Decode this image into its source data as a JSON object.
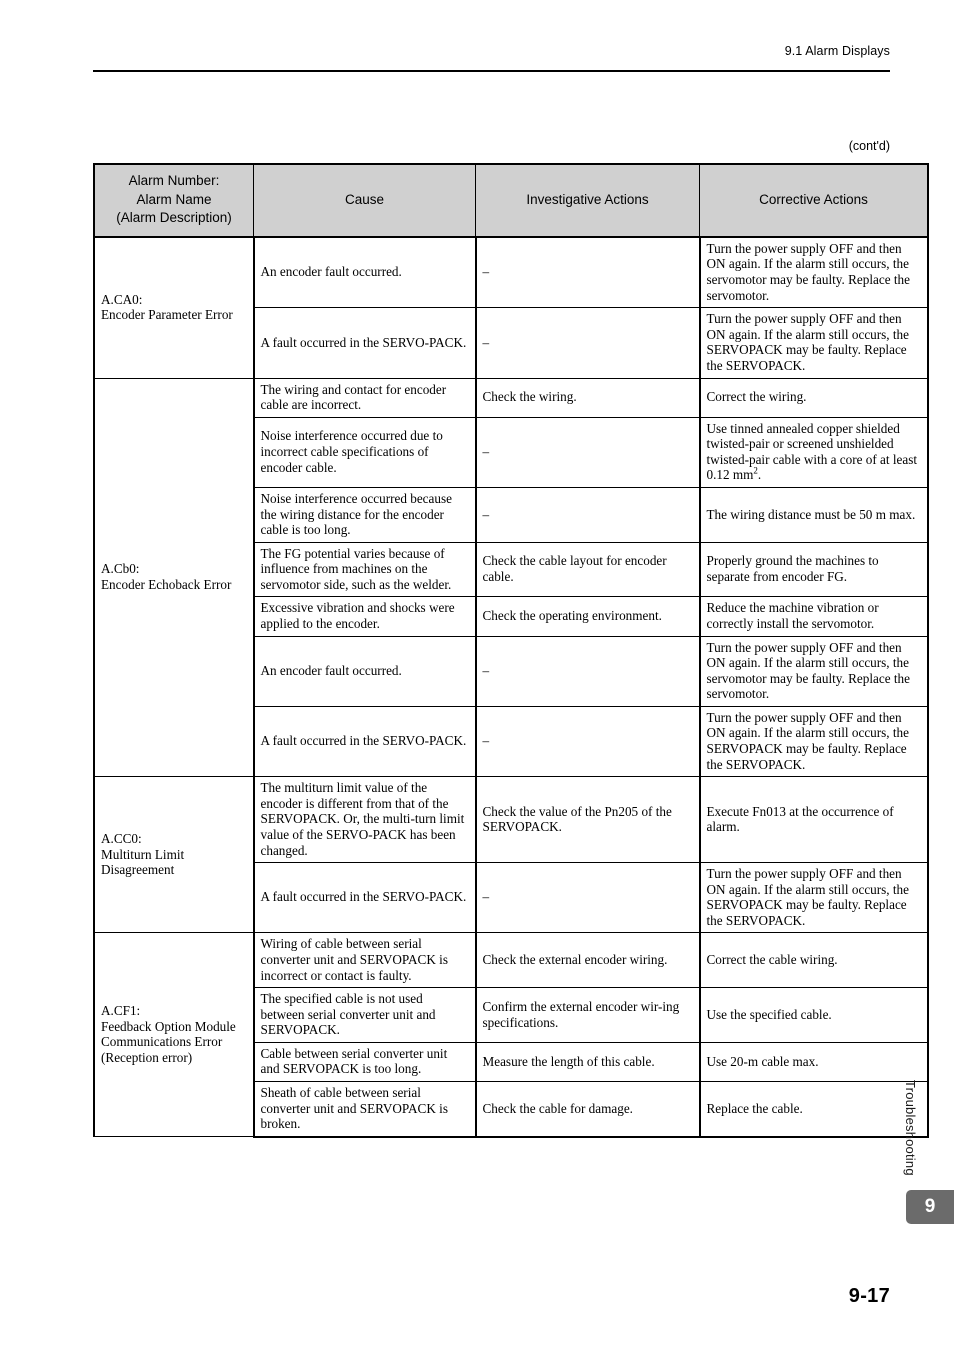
{
  "header": {
    "section_title": "9.1  Alarm Displays",
    "continued_note": "(cont'd)"
  },
  "table": {
    "columns": [
      "Alarm Number:\nAlarm Name\n(Alarm Description)",
      "Cause",
      "Investigative Actions",
      "Corrective Actions"
    ],
    "column_headers": {
      "alarm_line1": "Alarm Number:",
      "alarm_line2": "Alarm Name",
      "alarm_line3": "(Alarm Description)",
      "cause": "Cause",
      "investigative": "Investigative Actions",
      "corrective": "Corrective Actions"
    },
    "groups": [
      {
        "alarm_number": "A.CA0:",
        "alarm_name": "Encoder Parameter Error",
        "alarm_description": "",
        "rows": [
          {
            "cause": "An encoder fault occurred.",
            "investigative": "–",
            "corrective": "Turn the power supply OFF and then ON again. If the alarm still occurs, the servomotor may be faulty. Replace the servomotor."
          },
          {
            "cause": "A fault occurred in the SERVO-PACK.",
            "investigative": "–",
            "corrective": "Turn the power supply OFF and then ON again. If the alarm still occurs, the SERVOPACK may be faulty. Replace the SERVOPACK."
          }
        ]
      },
      {
        "alarm_number": "A.Cb0:",
        "alarm_name": "Encoder Echoback Error",
        "alarm_description": "",
        "rows": [
          {
            "cause": "The wiring and contact for encoder cable are incorrect.",
            "investigative": "Check the wiring.",
            "corrective": "Correct the wiring."
          },
          {
            "cause": "Noise interference occurred due to incorrect cable specifications of encoder cable.",
            "investigative": "–",
            "corrective_html": "Use tinned annealed copper shielded twisted-pair or screened unshielded twisted-pair cable with a core of at least 0.12 mm<sup>2</sup>.",
            "corrective": "Use tinned annealed copper shielded twisted-pair or screened unshielded twisted-pair cable with a core of at least 0.12 mm2."
          },
          {
            "cause": "Noise interference occurred because the wiring distance for the encoder cable is too long.",
            "investigative": "–",
            "corrective": "The wiring distance must be 50 m max."
          },
          {
            "cause": "The FG potential varies because of influence from machines on the servomotor side, such as the welder.",
            "investigative": "Check the cable layout for encoder cable.",
            "corrective": "Properly ground the machines to separate from encoder FG."
          },
          {
            "cause": "Excessive vibration and shocks were applied to the encoder.",
            "investigative": "Check the operating environment.",
            "corrective": "Reduce the machine vibration or correctly install the servomotor."
          },
          {
            "cause": "An encoder fault occurred.",
            "investigative": "–",
            "corrective": "Turn the power supply OFF and then ON again. If the alarm still occurs, the servomotor may be faulty. Replace the servomotor."
          },
          {
            "cause": "A fault occurred in the SERVO-PACK.",
            "investigative": "–",
            "corrective": "Turn the power supply OFF and then ON again. If the alarm still occurs, the SERVOPACK may be faulty. Replace the SERVOPACK."
          }
        ]
      },
      {
        "alarm_number": "A.CC0:",
        "alarm_name": "Multiturn Limit Disagreement",
        "alarm_description": "",
        "rows": [
          {
            "cause": "The multiturn limit value of the encoder is different from that of the SERVOPACK. Or, the multi-turn limit value of the SERVO-PACK has been changed.",
            "investigative": "Check the value of the Pn205 of the SERVOPACK.",
            "corrective": "Execute Fn013 at the occurrence of alarm."
          },
          {
            "cause": "A fault occurred in the SERVO-PACK.",
            "investigative": "–",
            "corrective": "Turn the power supply OFF and then ON again. If the alarm still occurs, the SERVOPACK may be faulty. Replace the SERVOPACK."
          }
        ]
      },
      {
        "alarm_number": "A.CF1:",
        "alarm_name": "Feedback Option Module Communications Error",
        "alarm_description": "(Reception error)",
        "rows": [
          {
            "cause": "Wiring of cable between serial converter unit and SERVOPACK is incorrect or contact is faulty.",
            "investigative": "Check the external encoder wiring.",
            "corrective": "Correct the cable wiring."
          },
          {
            "cause": "The specified cable is not used between serial converter unit and SERVOPACK.",
            "investigative": "Confirm the external encoder wir-ing specifications.",
            "corrective": "Use the specified cable."
          },
          {
            "cause": "Cable between serial converter unit and SERVOPACK is too long.",
            "investigative": "Measure the length of this cable.",
            "corrective": "Use 20-m cable max."
          },
          {
            "cause": "Sheath of cable between serial converter unit and SERVOPACK is broken.",
            "investigative": "Check the cable for damage.",
            "corrective": "Replace the cable."
          }
        ]
      }
    ]
  },
  "side": {
    "chapter_label": "Troubleshooting",
    "chapter_number": "9"
  },
  "footer": {
    "page_number": "9-17"
  },
  "colors": {
    "header_fill": "#d0d0d0",
    "tab_fill": "#6b6b6b",
    "text": "#000000"
  }
}
